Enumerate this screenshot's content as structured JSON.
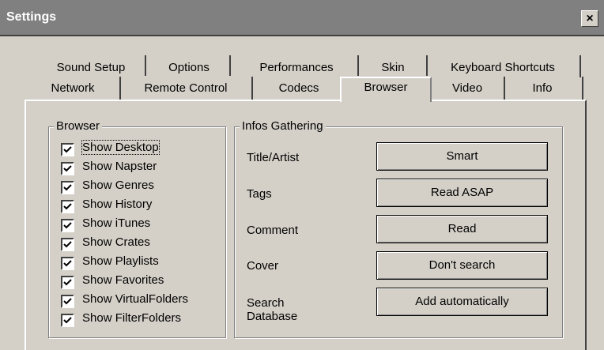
{
  "window": {
    "title": "Settings",
    "close_glyph": "×"
  },
  "tabs": {
    "row1": [
      "Sound Setup",
      "Options",
      "Performances",
      "Skin",
      "Keyboard Shortcuts"
    ],
    "row2": [
      "Network",
      "Remote Control",
      "Codecs",
      "Browser",
      "Video",
      "Info"
    ],
    "active": "Browser"
  },
  "browser_group": {
    "title": "Browser",
    "items": [
      {
        "label": "Show Desktop",
        "checked": true
      },
      {
        "label": "Show Napster",
        "checked": true
      },
      {
        "label": "Show Genres",
        "checked": true
      },
      {
        "label": "Show History",
        "checked": true
      },
      {
        "label": "Show iTunes",
        "checked": true
      },
      {
        "label": "Show Crates",
        "checked": true
      },
      {
        "label": "Show Playlists",
        "checked": true
      },
      {
        "label": "Show Favorites",
        "checked": true
      },
      {
        "label": "Show VirtualFolders",
        "checked": true
      },
      {
        "label": "Show FilterFolders",
        "checked": true
      }
    ]
  },
  "infos_group": {
    "title": "Infos Gathering",
    "rows": [
      {
        "label": "Title/Artist",
        "value": "Smart"
      },
      {
        "label": "Tags",
        "value": "Read ASAP"
      },
      {
        "label": "Comment",
        "value": "Read"
      },
      {
        "label": "Cover",
        "value": "Don't search"
      },
      {
        "label": "Search Database",
        "value": "Add automatically"
      }
    ]
  }
}
